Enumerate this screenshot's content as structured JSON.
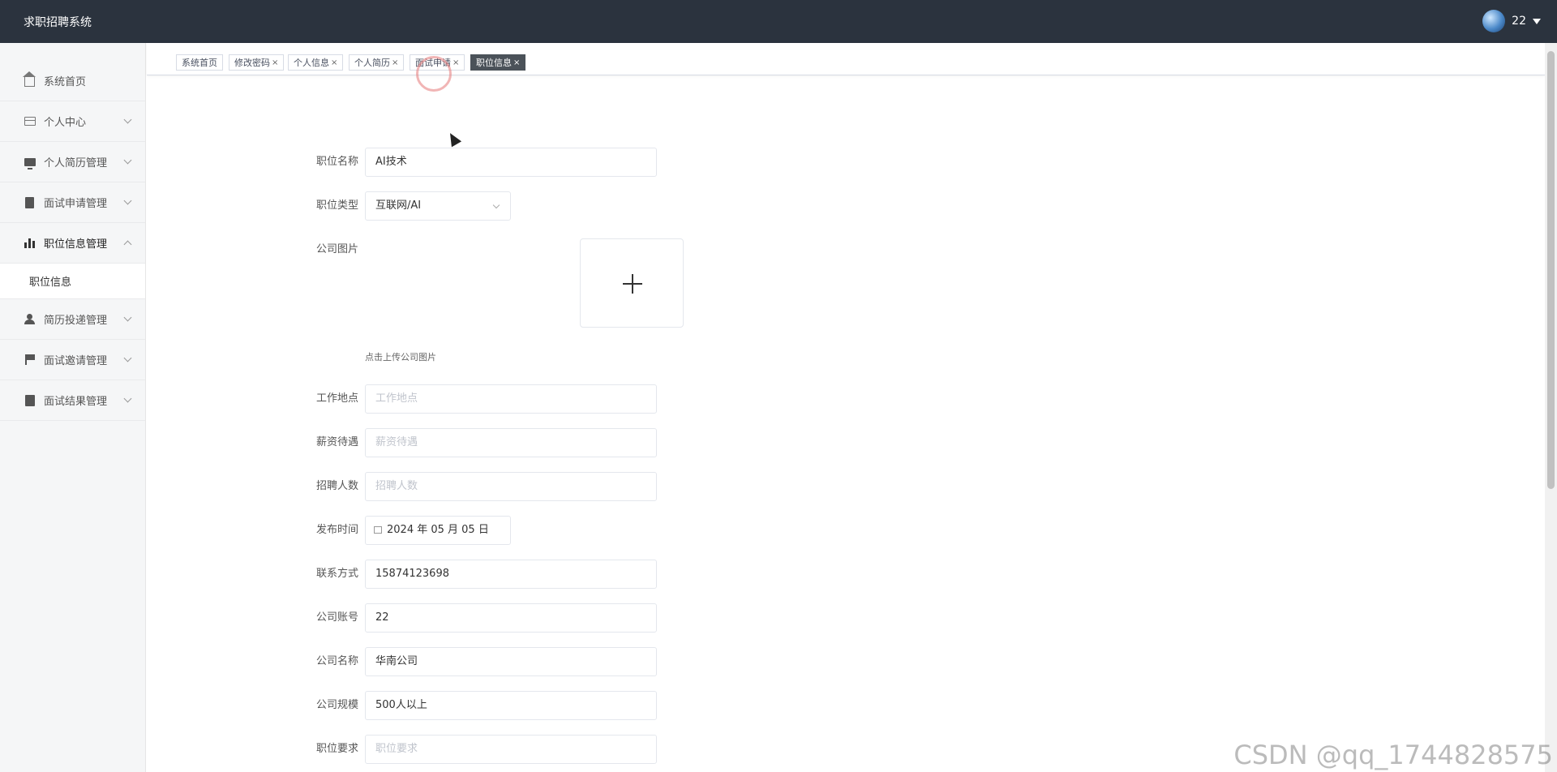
{
  "header": {
    "brand": "求职招聘系统",
    "user_name": "22"
  },
  "sidebar": {
    "items": [
      {
        "label": "系统首页",
        "icon": "home-icon"
      },
      {
        "label": "个人中心",
        "icon": "card-icon"
      },
      {
        "label": "个人简历管理",
        "icon": "monitor-icon"
      },
      {
        "label": "面试申请管理",
        "icon": "clipboard-icon"
      },
      {
        "label": "职位信息管理",
        "icon": "bar-chart-icon",
        "expanded": true,
        "children": [
          {
            "label": "职位信息"
          }
        ]
      },
      {
        "label": "简历投递管理",
        "icon": "user-icon"
      },
      {
        "label": "面试邀请管理",
        "icon": "flag-icon"
      },
      {
        "label": "面试结果管理",
        "icon": "check-icon"
      }
    ]
  },
  "tabs": [
    {
      "label": "系统首页",
      "closable": false
    },
    {
      "label": "修改密码",
      "closable": true
    },
    {
      "label": "个人信息",
      "closable": true
    },
    {
      "label": "个人简历",
      "closable": true
    },
    {
      "label": "面试申请",
      "closable": true
    },
    {
      "label": "职位信息",
      "closable": true,
      "active": true
    }
  ],
  "form": {
    "job_name": {
      "label": "职位名称",
      "value": "AI技术"
    },
    "job_type": {
      "label": "职位类型",
      "value": "互联网/AI"
    },
    "company_image": {
      "label": "公司图片",
      "hint": "点击上传公司图片"
    },
    "work_location": {
      "label": "工作地点",
      "placeholder": "工作地点"
    },
    "salary": {
      "label": "薪资待遇",
      "placeholder": "薪资待遇"
    },
    "headcount": {
      "label": "招聘人数",
      "placeholder": "招聘人数"
    },
    "publish_date": {
      "label": "发布时间",
      "value": "2024 年 05 月 05 日"
    },
    "contact": {
      "label": "联系方式",
      "value": "15874123698"
    },
    "company_account": {
      "label": "公司账号",
      "value": "22"
    },
    "company_name": {
      "label": "公司名称",
      "value": "华南公司"
    },
    "company_size": {
      "label": "公司规模",
      "value": "500人以上"
    },
    "requirements": {
      "label": "职位要求",
      "placeholder": "职位要求"
    }
  },
  "watermark": "CSDN @qq_1744828575",
  "colors": {
    "header_bg": "#2b333e",
    "active_tab_bg": "#4b5259",
    "sidebar_bg": "#f5f6f7"
  }
}
